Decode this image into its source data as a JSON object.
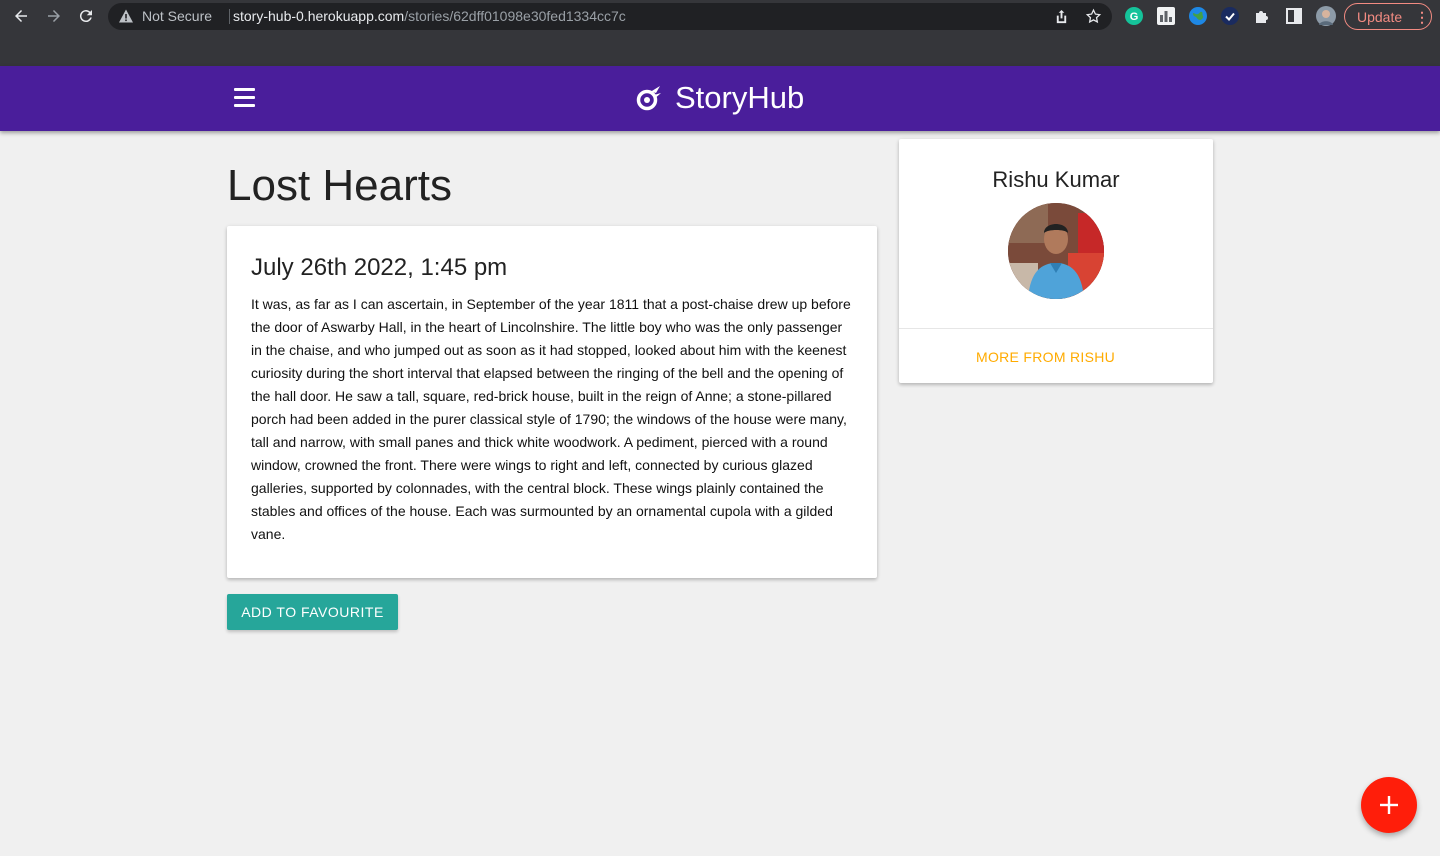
{
  "browser": {
    "security_label": "Not Secure",
    "url_host": "story-hub-0.herokuapp.com",
    "url_path": "/stories/62dff01098e30fed1334cc7c",
    "update_label": "Update",
    "menu_dots": "⋮",
    "toolbar_bg": "#35363a",
    "update_color": "#f28b82"
  },
  "appbar": {
    "brand": "StoryHub",
    "menu_icon": "hamburger-menu-icon",
    "brand_icon": "comet-icon",
    "color": "#4a1e9b"
  },
  "story": {
    "title": "Lost Hearts",
    "date": "July 26th 2022, 1:45 pm",
    "body": "It was, as far as I can ascertain, in September of the year 1811 that a post-chaise drew up before the door of Aswarby Hall, in the heart of Lincolnshire. The little boy who was the only passenger in the chaise, and who jumped out as soon as it had stopped, looked about him with the keenest curiosity during the short interval that elapsed between the ringing of the bell and the opening of the hall door. He saw a tall, square, red-brick house, built in the reign of Anne; a stone-pillared porch had been added in the purer classical style of 1790; the windows of the house were many, tall and narrow, with small panes and thick white woodwork. A pediment, pierced with a round window, crowned the front. There were wings to right and left, connected by curious glazed galleries, supported by colonnades, with the central block. These wings plainly contained the stables and offices of the house. Each was surmounted by an ornamental cupola with a gilded vane.",
    "favourite_label": "ADD TO FAVOURITE",
    "favourite_color": "#26a69a"
  },
  "author": {
    "name": "Rishu Kumar",
    "more_label": "MORE FROM RISHU",
    "more_color": "#ffab00"
  },
  "fab": {
    "icon": "plus-icon",
    "color": "#ff1e0a"
  }
}
